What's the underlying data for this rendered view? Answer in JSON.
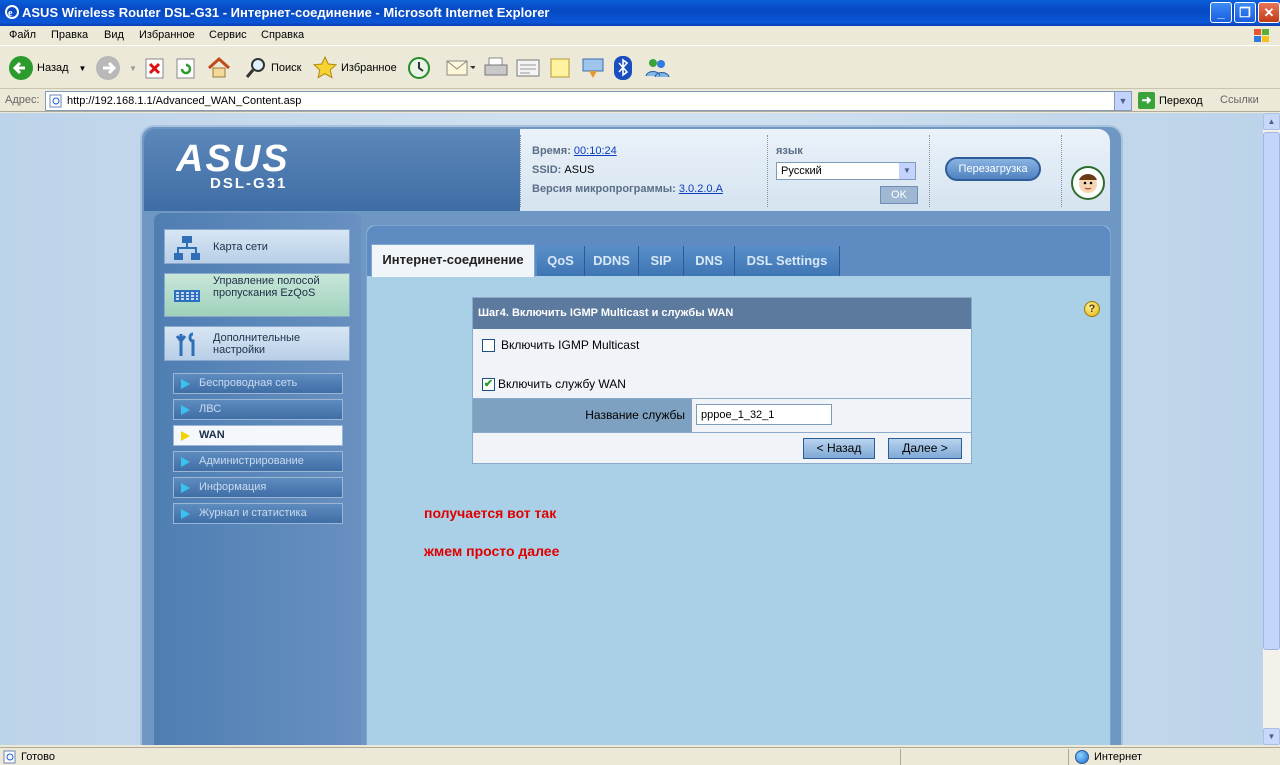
{
  "window": {
    "title": "ASUS Wireless Router DSL-G31 - Интернет-соединение - Microsoft Internet Explorer",
    "minimize": "_",
    "maximize": "❐",
    "close": "✕"
  },
  "menu": [
    "Файл",
    "Правка",
    "Вид",
    "Избранное",
    "Сервис",
    "Справка"
  ],
  "toolbar": {
    "back": "Назад",
    "search": "Поиск",
    "favorites": "Избранное"
  },
  "address": {
    "label": "Адрес:",
    "url": "http://192.168.1.1/Advanced_WAN_Content.asp",
    "go": "Переход",
    "links": "Ссылки"
  },
  "router": {
    "model": "DSL-G31",
    "info": {
      "time_label": "Время:",
      "time_value": "00:10:24",
      "ssid_label": "SSID:",
      "ssid_value": "ASUS",
      "fw_label": "Версия микропрограммы:",
      "fw_value": "3.0.2.0.A"
    },
    "language": {
      "label": "язык",
      "selected": "Русский",
      "ok": "OK"
    },
    "reboot": "Перезагрузка"
  },
  "sidebar": {
    "main_items": [
      {
        "label": "Карта сети",
        "icon": "network-map-icon"
      },
      {
        "label": "Управление полосой пропускания EzQoS",
        "icon": "ezqos-icon"
      },
      {
        "label": "Дополнительные настройки",
        "icon": "tools-icon"
      }
    ],
    "sub_items": [
      {
        "label": "Беспроводная сеть",
        "active": false
      },
      {
        "label": "ЛВС",
        "active": false
      },
      {
        "label": "WAN",
        "active": true
      },
      {
        "label": "Администрирование",
        "active": false
      },
      {
        "label": "Информация",
        "active": false
      },
      {
        "label": "Журнал и статистика",
        "active": false
      }
    ]
  },
  "tabs": [
    {
      "label": "Интернет-соединение",
      "active": true
    },
    {
      "label": "QoS",
      "active": false
    },
    {
      "label": "DDNS",
      "active": false
    },
    {
      "label": "SIP",
      "active": false
    },
    {
      "label": "DNS",
      "active": false
    },
    {
      "label": "DSL Settings",
      "active": false
    }
  ],
  "form": {
    "heading": "Шаг4. Включить IGMP Multicast и службы WAN",
    "igmp": {
      "label": "Включить IGMP Multicast",
      "checked": false
    },
    "wan_service": {
      "label": "Включить службу WAN",
      "checked": true
    },
    "service_name_label": "Название службы",
    "service_name_value": "pppoe_1_32_1",
    "back": "< Назад",
    "next": "Далее >"
  },
  "annotations": {
    "line1": "получается вот так",
    "line2": "жмем просто далее"
  },
  "status": {
    "text": "Готово",
    "zone": "Интернет"
  }
}
